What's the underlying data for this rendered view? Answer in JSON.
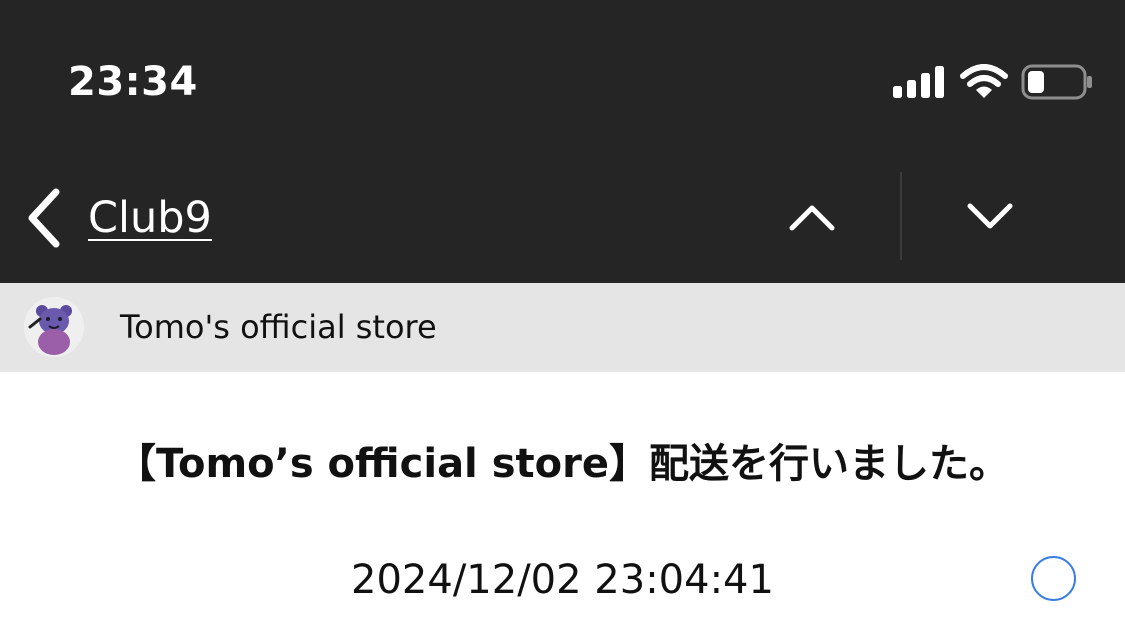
{
  "status_bar": {
    "time": "23:34",
    "icons": [
      "signal-icon",
      "wifi-icon",
      "battery-icon"
    ],
    "battery_level": 0.3
  },
  "nav": {
    "back_label": "Club9",
    "prev_icon": "chevron-up-icon",
    "next_icon": "chevron-down-icon"
  },
  "sender": {
    "name": "Tomo's official store",
    "avatar_icon": "bear-avatar"
  },
  "message": {
    "title": "【Tomo’s official store】配送を行いました。",
    "date": "2024/12/02 23:04:41"
  },
  "colors": {
    "header_bg": "#252525",
    "sender_bar_bg": "#e5e5e5",
    "accent": "#3a7ee0"
  }
}
